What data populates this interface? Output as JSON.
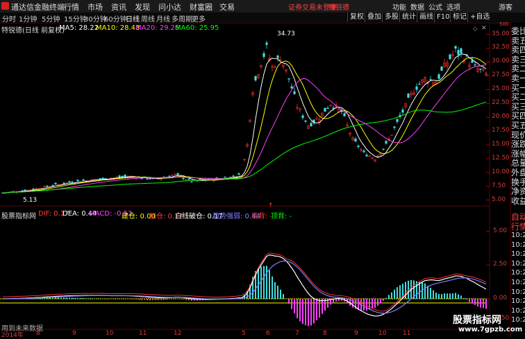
{
  "menubar": {
    "app_title": "通达信金融终端",
    "items": [
      "行情",
      "市场",
      "资讯",
      "发现",
      "问小达",
      "财富圈",
      "交易"
    ],
    "login_status": "证券交易未登录",
    "stock_name": "特锐德",
    "right_items": [
      "功能",
      "数据",
      "公式",
      "选项"
    ],
    "guest": "游客"
  },
  "toolbar": {
    "periods": [
      "分时",
      "1分钟",
      "5分钟",
      "15分钟",
      "30分钟",
      "60分钟",
      "日线",
      "周线",
      "月线",
      "多周期",
      "更多"
    ],
    "active": "日线",
    "right_buttons": [
      "复权",
      "叠加",
      "多股",
      "统计",
      "画线",
      "F10",
      "标记",
      "+自选"
    ]
  },
  "main_chart": {
    "title": "特锐德(日线 前复权)",
    "ma_labels": [
      {
        "label": "MA5: 28.22",
        "color": "#ffffff"
      },
      {
        "label": "MA10: 28.43",
        "color": "#ffff00"
      },
      {
        "label": "MA20: 29.26",
        "color": "#ff40ff"
      },
      {
        "label": "MA60: 25.95",
        "color": "#00ff00"
      }
    ],
    "high_label": "34.73",
    "low_label": "5.13",
    "unit_label": "500",
    "arrow": "↑",
    "y_ticks": [
      "35.00",
      "32.50",
      "30.00",
      "27.50",
      "25.00",
      "22.50",
      "20.00",
      "17.50",
      "15.00",
      "12.50",
      "10.00",
      "7.50",
      "5.00"
    ],
    "y_max": 36.2,
    "y_min": 4.2,
    "colors": {
      "up": "#ff3030",
      "down": "#40e0e0"
    }
  },
  "indicator": {
    "title": "股票指标网",
    "labels": [
      {
        "label": "DIF: 0.17",
        "color": "#ff4040"
      },
      {
        "label": "DEA: 0.44",
        "color": "#ffffff"
      },
      {
        "label": "MACD: -0.53",
        "color": "#ff40ff"
      },
      {
        "label": "建仓: 0.00",
        "color": "#ffff00"
      },
      {
        "label": "加仓: 0.17",
        "color": "#ff4040"
      },
      {
        "label": "白线破仓: 0.17",
        "color": "#ffffff"
      },
      {
        "label": "趋势强弱: 0.44",
        "color": "#8080ff"
      },
      {
        "label": "底背: -",
        "color": "#ff4040"
      },
      {
        "label": "顶背: -",
        "color": "#00ff00"
      }
    ],
    "y_ticks": [
      "5.00",
      "2.50",
      "0.00",
      "-1.50"
    ],
    "y_max": 5.8,
    "y_min": -2.0
  },
  "dates": {
    "year": "2014年",
    "months": [
      "8",
      "9",
      "10",
      "11",
      "12",
      "5",
      "6",
      "7",
      "8",
      "9",
      "10",
      "11"
    ]
  },
  "status_text": "用到未来数据",
  "right_panel": {
    "labels": [
      "委比",
      "卖五",
      "卖四",
      "卖三",
      "卖二",
      "卖一",
      "买一",
      "买二",
      "买三",
      "买四",
      "买五",
      "现价",
      "涨跌",
      "涨幅",
      "总量",
      "外盘",
      "换手",
      "净资",
      "收益"
    ],
    "tabs": [
      "自动",
      "行情"
    ],
    "times": [
      "10:26",
      "10:26",
      "10:26",
      "10:26",
      "10:26",
      "10:26",
      "10:26",
      "10:26",
      "10:26",
      "10:26"
    ]
  },
  "watermark": {
    "title": "股票指标网",
    "url": "www.7gpzb.com"
  }
}
